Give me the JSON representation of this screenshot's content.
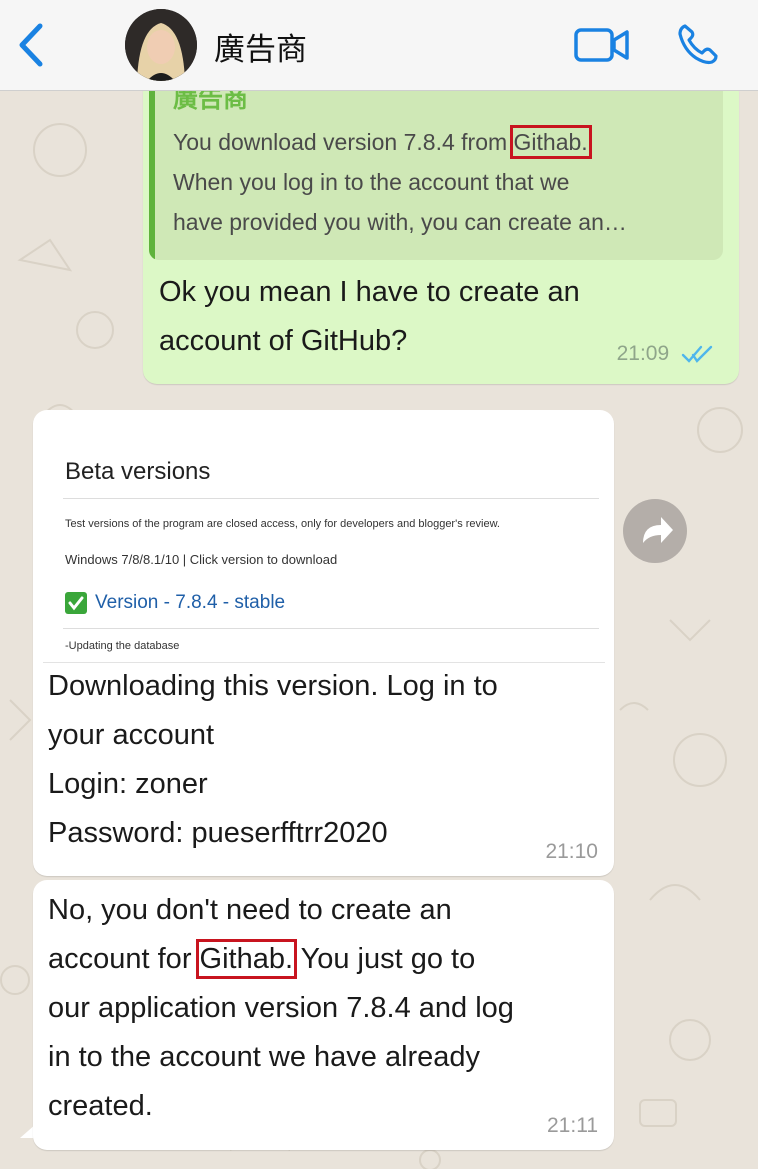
{
  "header": {
    "contact_name": "廣告商",
    "back_icon": "chevron-left-icon",
    "video_icon": "video-camera-icon",
    "call_icon": "phone-icon",
    "accent_color": "#1a82e2"
  },
  "messages": {
    "outgoing": {
      "quoted_author": "廣告商",
      "quoted_lines": [
        "You download version 7.8.4 from ",
        "Githab.",
        "When you log in to the account that we",
        "have provided you with, you can create an…"
      ],
      "lines": [
        "Ok you mean I have to create an",
        "account of GitHub?"
      ],
      "time": "21:09",
      "read_receipt": "double-check-icon"
    },
    "incoming_1": {
      "card": {
        "title": "Beta versions",
        "description": "Test versions of the program are closed access, only for developers and blogger's review.",
        "os_line": "Windows 7/8/8.1/10 | Click version to download",
        "version_label": "Version - 7.8.4 - stable",
        "update_note": "-Updating the database"
      },
      "lines": [
        "Downloading this version. Log in to",
        "your account",
        "Login: zoner",
        "Password: pueserfftrr2020"
      ],
      "time": "21:10"
    },
    "incoming_2": {
      "line1": "No, you don't need to create an",
      "line2_before": "account for ",
      "line2_highlight": "Githab.",
      "line2_after": " You just go to",
      "line3": "our application version 7.8.4 and log",
      "line4": "in to the account we have already",
      "line5": "created.",
      "time": "21:11"
    }
  },
  "forward_icon": "forward-arrow-icon",
  "colors": {
    "outgoing_bubble": "#dcf8c6",
    "incoming_bubble": "#ffffff",
    "highlight_box": "#c8141f",
    "quote_author": "#6cbd45"
  }
}
